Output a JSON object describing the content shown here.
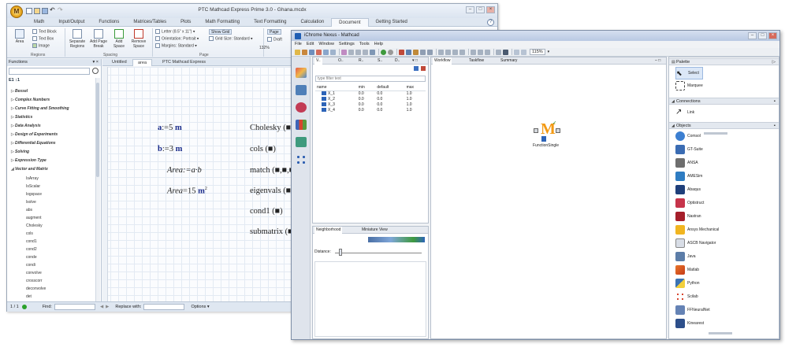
{
  "mathcad": {
    "title": "PTC Mathcad Express Prime 3.0 - Ghana.mcdx",
    "logo_letter": "M",
    "tabs": [
      "Math",
      "Input/Output",
      "Functions",
      "Matrices/Tables",
      "Plots",
      "Math Formatting",
      "Text Formatting",
      "Calculation",
      "Document",
      "Getting Started"
    ],
    "active_tab": "Document",
    "ribbon": {
      "area": "Area",
      "text_block": "Text Block",
      "text_box": "Text Box",
      "image": "Image",
      "regions_group": "Regions",
      "separate_regions": "Separate Regions",
      "add_page_break": "Add Page Break",
      "add_space": "Add Space",
      "remove_space": "Remove Space",
      "spacing_group": "Spacing",
      "letter": "Letter (8.5\" x 11\")",
      "orientation": "Orientation:",
      "orientation_value": "Portrait",
      "margins": "Margins:",
      "margins_value": "Standard",
      "show_grid": "Show Grid",
      "grid_size": "Grid Size:",
      "grid_size_value": "Standard",
      "page_group": "Page",
      "view_page": "Page",
      "view_draft": "Draft",
      "zoom": "132%"
    },
    "functions_panel": {
      "title": "Functions",
      "sort_label": "E1 ↕1",
      "categories": [
        "Bessel",
        "Complex Numbers",
        "Curve Fitting and Smoothing",
        "Statistics",
        "Data Analysis",
        "Design of Experiments",
        "Differential Equations",
        "Solving",
        "Expression Type",
        "Vector and Matrix"
      ],
      "items": [
        "IsArray",
        "IsScalar",
        "logspace",
        "lsolve",
        "abs",
        "augment",
        "Cholesky",
        "cols",
        "cond1",
        "cond2",
        "conde",
        "condi",
        "convolve",
        "crosscorr",
        "deconvolve",
        "det"
      ]
    },
    "worksheet_tabs": [
      "Untitled",
      "area",
      "PTC Mathcad Express"
    ],
    "active_ws_tab": "area",
    "math": {
      "line1_lhs": "a",
      "line1_rhs": "5",
      "line1_unit": "m",
      "line2_lhs": "b",
      "line2_rhs": "3",
      "line2_unit": "m",
      "line3_lhs": "Area",
      "line3_rhs": "a·b",
      "line4_lhs": "Area",
      "line4_rhs": "15",
      "line4_unit": "m",
      "line4_exp": "2",
      "assign_op": ":=",
      "eval_op": "=",
      "funcs": [
        "Cholesky (■)",
        "cols (■)",
        "match (■,■,■)",
        "eigenvals (■)",
        "cond1 (■)",
        "submatrix (■"
      ]
    },
    "status": {
      "page": "1 / 1",
      "find": "Find:",
      "replace": "Replace with:",
      "options": "Options ▾"
    }
  },
  "ichrome": {
    "title": "iChrome Nexus - Mathcad",
    "menus": [
      "File",
      "Edit",
      "Window",
      "Settings",
      "Tools",
      "Help"
    ],
    "zoom": "115%",
    "left_tabs": [
      "V..",
      "O..",
      "R..",
      "S..",
      "D.."
    ],
    "filter_placeholder": "type filter text",
    "var_columns": [
      "name",
      "min",
      "default",
      "max"
    ],
    "variables": [
      {
        "name": "X_1",
        "min": "0.0",
        "default": "0.0",
        "max": "1.0"
      },
      {
        "name": "X_2",
        "min": "0.0",
        "default": "0.0",
        "max": "1.0"
      },
      {
        "name": "X_3",
        "min": "0.0",
        "default": "0.0",
        "max": "1.0"
      },
      {
        "name": "X_4",
        "min": "0.0",
        "default": "0.0",
        "max": "1.0"
      }
    ],
    "nb_tabs": [
      "Neighborhood",
      "Miniature View"
    ],
    "distance_label": "Distance:",
    "center_tabs": [
      "Workflow",
      "Taskflow",
      "Summary"
    ],
    "node_label": "FunctionSingle",
    "palette": {
      "title": "Palette",
      "select": "Select",
      "marquee": "Marquee",
      "connections": "Connections",
      "link": "Link",
      "objects": "Objects",
      "items": [
        "Comsol",
        "GT-Suite",
        "ANSA",
        "AMESim",
        "Abaqus",
        "Optistruct",
        "Nastran",
        "Ansys Mechanical",
        "ASCB Navigator",
        "Java",
        "Matlab",
        "Python",
        "Scilab",
        "FFNeuralNet",
        "Kinearest"
      ]
    }
  }
}
